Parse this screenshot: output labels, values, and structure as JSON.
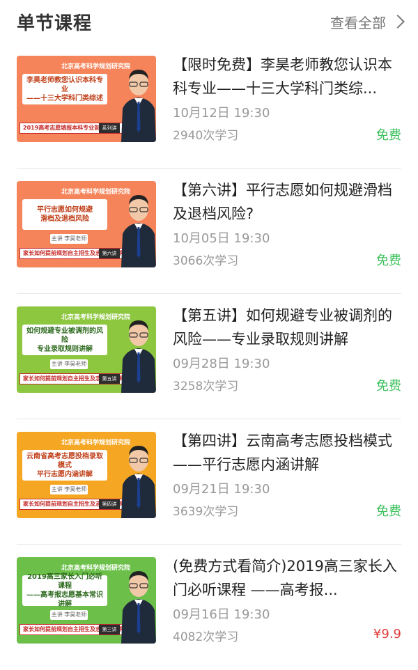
{
  "header": {
    "title": "单节课程",
    "view_all": "查看全部"
  },
  "colors": {
    "free": "#3cc05c",
    "paid": "#e03b3b"
  },
  "courses": [
    {
      "title": "【限时免费】李昊老师教您认识本科专业——十三大学科门类综...",
      "date": "10月12日 19:30",
      "count": "2940次学习",
      "price": "免费",
      "thumb": {
        "bg": "#f5845a",
        "logo": "北京高考科学规划研究院",
        "box_lines": [
          "李昊老师教您认识本科专业",
          "——十三大学科门类综述"
        ],
        "chip": "",
        "banner": "2019高考志愿填报本科专业剖析讲座",
        "ep": "系列讲"
      }
    },
    {
      "title": "【第六讲】平行志愿如何规避滑档及退档风险?",
      "date": "10月05日 19:30",
      "count": "3066次学习",
      "price": "免费",
      "thumb": {
        "bg": "#f5845a",
        "logo": "北京高考科学规划研究院",
        "box_lines": [
          "平行志愿如何规避",
          "滑档及退档风险"
        ],
        "chip": "主讲 李昊老师",
        "banner": "家长如何提前规划自主招生及志愿填报系列",
        "ep": "第六讲"
      }
    },
    {
      "title": "【第五讲】如何规避专业被调剂的风险——专业录取规则讲解",
      "date": "09月28日 19:30",
      "count": "3258次学习",
      "price": "免费",
      "thumb": {
        "bg": "#8dc63f",
        "logo": "北京高考科学规划研究院",
        "box_lines": [
          "如何规避专业被调剂的风险",
          "专业录取规则讲解"
        ],
        "chip": "主讲 李昊老师",
        "banner": "家长如何提前规划自主招生及志愿填报系列",
        "ep": "第五讲"
      }
    },
    {
      "title": "【第四讲】云南高考志愿投档模式——平行志愿内涵讲解",
      "date": "09月21日 19:30",
      "count": "3639次学习",
      "price": "免费",
      "thumb": {
        "bg": "#f5a623",
        "logo": "北京高考科学规划研究院",
        "box_lines": [
          "云南省高考志愿投档录取模式",
          "平行志愿内涵讲解"
        ],
        "chip": "主讲 李昊老师",
        "banner": "家长如何提前规划自主招生及志愿填报系列",
        "ep": "第四讲"
      }
    },
    {
      "title": "(免费方式看简介)2019高三家长入门必听课程 ——高考报...",
      "date": "09月16日 19:30",
      "count": "4082次学习",
      "price": "¥9.9",
      "thumb": {
        "bg": "#6cc04a",
        "logo": "北京高考科学规划研究院",
        "box_lines": [
          "2019高三家长入门必听课程",
          "——高考报志愿基本常识讲解"
        ],
        "chip": "主讲 李昊老师",
        "banner": "家长如何提前规划自主招生及志愿填报系列",
        "ep": "第三讲"
      }
    }
  ]
}
